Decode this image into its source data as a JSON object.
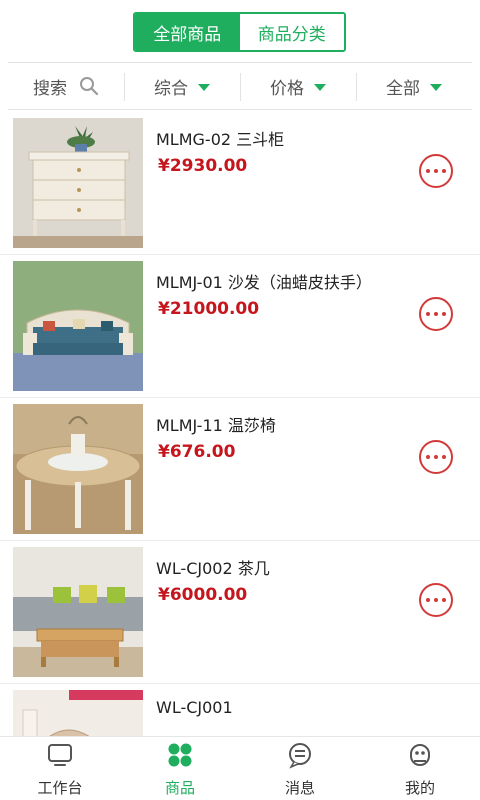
{
  "top_tabs": [
    {
      "label": "全部商品",
      "active": true
    },
    {
      "label": "商品分类",
      "active": false
    }
  ],
  "filters": {
    "search_label": "搜索",
    "sort_label": "综合",
    "price_label": "价格",
    "category_label": "全部"
  },
  "products": [
    {
      "name": "MLMG-02  三斗柜",
      "price": "¥2930.00"
    },
    {
      "name": "MLMJ-01  沙发（油蜡皮扶手）",
      "price": "¥21000.00"
    },
    {
      "name": "MLMJ-11  温莎椅",
      "price": "¥676.00"
    },
    {
      "name": "WL-CJ002  茶几",
      "price": "¥6000.00"
    },
    {
      "name": "WL-CJ001",
      "price": ""
    }
  ],
  "bottom_nav": [
    {
      "label": "工作台",
      "icon": "monitor-icon",
      "active": false
    },
    {
      "label": "商品",
      "icon": "grid-icon",
      "active": true
    },
    {
      "label": "消息",
      "icon": "chat-icon",
      "active": false
    },
    {
      "label": "我的",
      "icon": "robot-icon",
      "active": false
    }
  ],
  "colors": {
    "accent": "#1fae5e",
    "price": "#c4161c"
  }
}
